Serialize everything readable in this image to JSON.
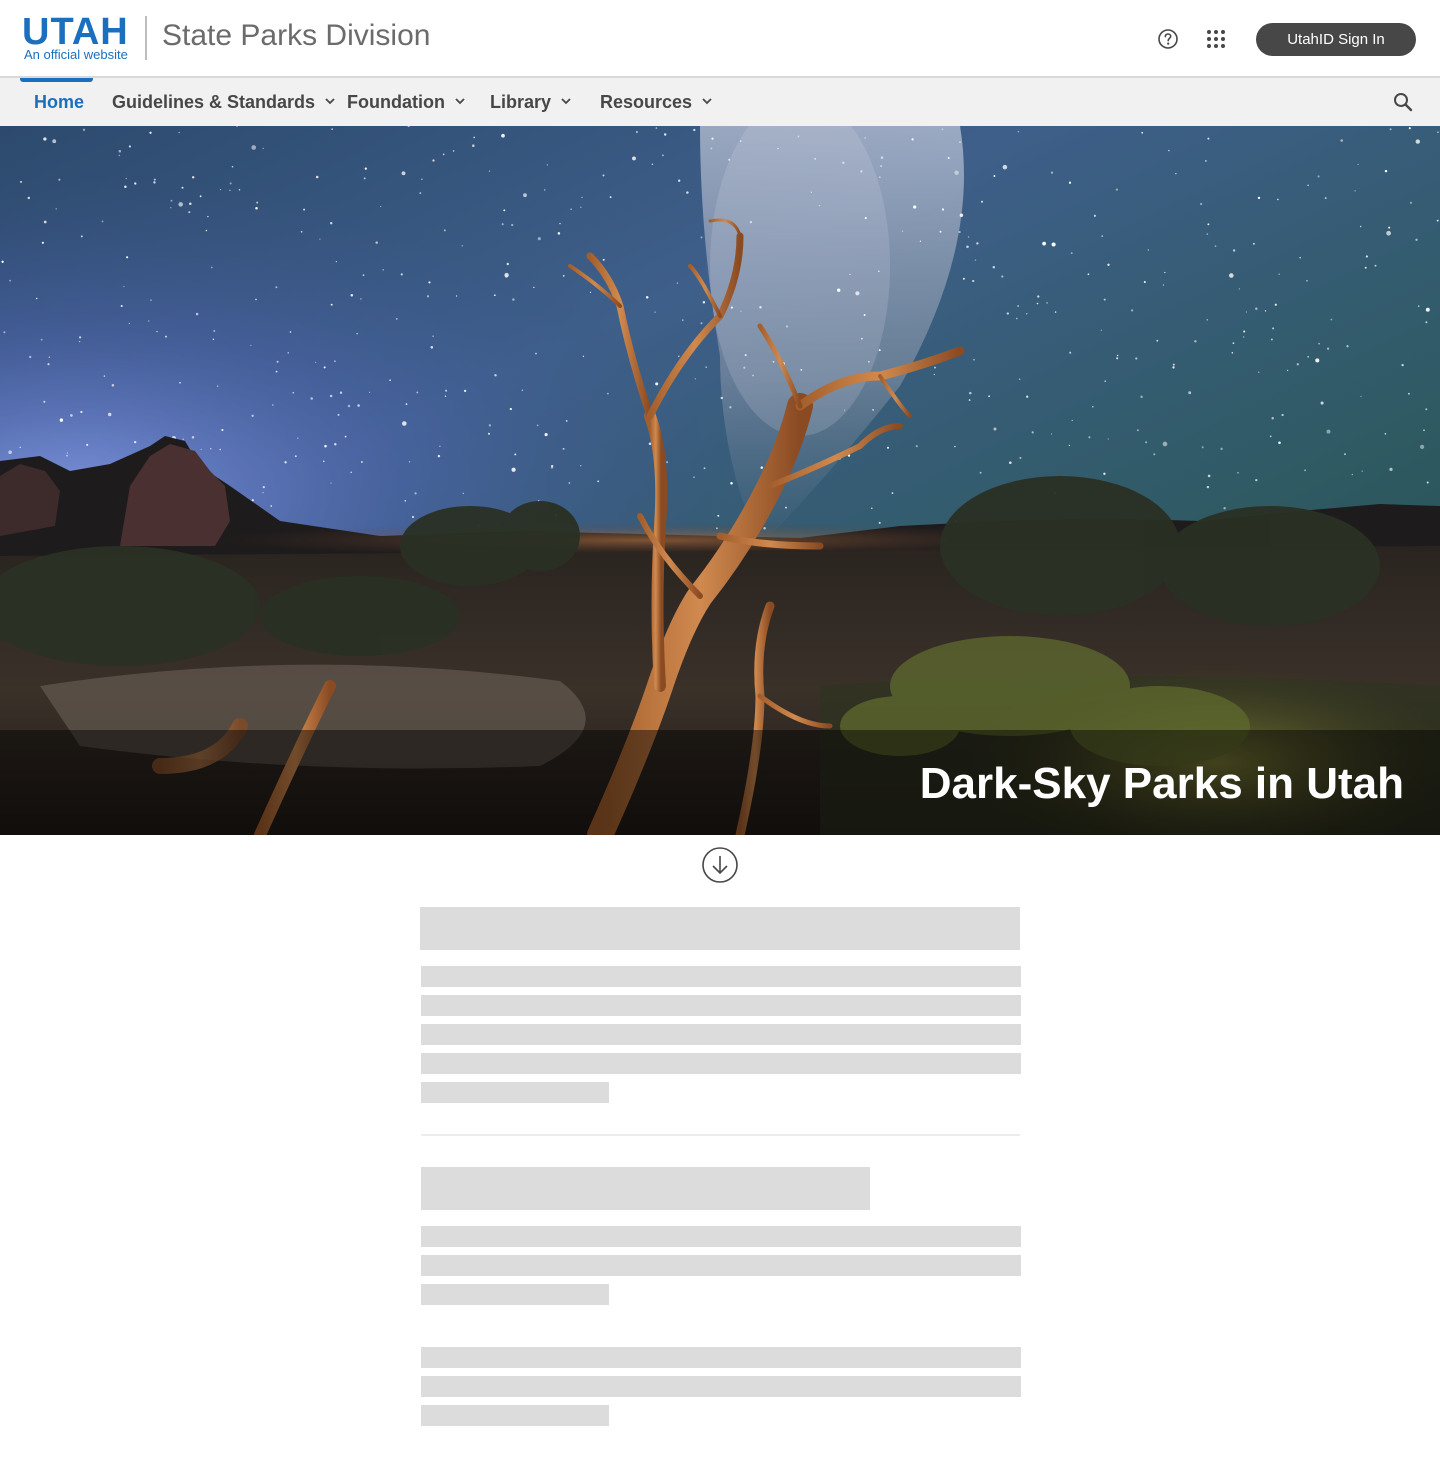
{
  "header": {
    "logo_text": "UTAH",
    "logo_subtext": "An official website",
    "site_title": "State Parks Division",
    "help_icon": "question-circle-icon",
    "apps_icon": "app-grid-icon",
    "signin_label": "UtahID Sign In"
  },
  "nav": {
    "items": [
      {
        "label": "Home",
        "active": true,
        "has_menu": false
      },
      {
        "label": "Guidelines & Standards",
        "active": false,
        "has_menu": true
      },
      {
        "label": "Foundation",
        "active": false,
        "has_menu": true
      },
      {
        "label": "Library",
        "active": false,
        "has_menu": true
      },
      {
        "label": "Resources",
        "active": false,
        "has_menu": true
      }
    ],
    "search_icon": "search-icon"
  },
  "hero": {
    "title": "Dark-Sky Parks in Utah",
    "image": "night-sky-milky-way-dead-tree-photo"
  },
  "scroll_icon": "arrow-down-circle-icon",
  "colors": {
    "brand_blue": "#1a6fbf",
    "text_dark": "#474747",
    "nav_bg": "#f1f1f1",
    "skeleton": "#dcdcdc"
  }
}
